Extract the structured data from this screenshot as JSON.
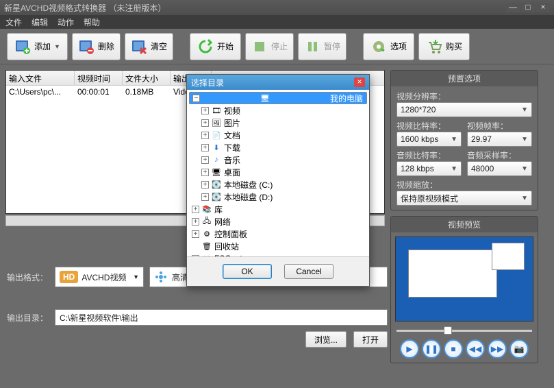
{
  "window": {
    "title": "新星AVCHD视频格式转换器  （未注册版本）"
  },
  "menu": {
    "file": "文件",
    "edit": "编辑",
    "action": "动作",
    "help": "帮助"
  },
  "toolbar": {
    "add": "添加",
    "delete": "删除",
    "clear": "清空",
    "start": "开始",
    "stop": "停止",
    "pause": "暂停",
    "options": "选项",
    "buy": "购买"
  },
  "table": {
    "headers": {
      "file": "输入文件",
      "time": "视频时间",
      "size": "文件大小",
      "format": "输出格式"
    },
    "rows": [
      {
        "file": "C:\\Users\\pc\\...",
        "time": "00:00:01",
        "size": "0.18MB",
        "format": "Vide"
      }
    ]
  },
  "preset": {
    "title": "预置选项",
    "resolution_label": "视频分辨率：",
    "resolution": "1280*720",
    "vbitrate_label": "视频比特率：",
    "vbitrate": "1600 kbps",
    "fps_label": "视频帧率：",
    "fps": "29.97",
    "abitrate_label": "音频比特率：",
    "abitrate": "128 kbps",
    "asample_label": "音频采样率：",
    "asample": "48000",
    "scale_label": "视频缩放：",
    "scale": "保持原视频模式"
  },
  "preview": {
    "title": "视频预览"
  },
  "output": {
    "format_label": "输出格式：",
    "hd": "HD",
    "format_type": "AVCHD视频",
    "format_value": "高清AVI视频格式(*.avi)",
    "dir_label": "输出目录：",
    "dir_value": "C:\\新星视频软件\\输出",
    "browse": "浏览...",
    "open": "打开"
  },
  "dialog": {
    "title": "选择目录",
    "ok": "OK",
    "cancel": "Cancel",
    "tree": {
      "my_computer": "我的电脑",
      "video": "视频",
      "pictures": "图片",
      "documents": "文档",
      "downloads": "下载",
      "music": "音乐",
      "desktop": "桌面",
      "disk_c": "本地磁盘 (C:)",
      "disk_d": "本地磁盘 (D:)",
      "library": "库",
      "network": "网络",
      "control_panel": "控制面板",
      "recycle": "回收站",
      "fscapture": "FSCapture"
    }
  }
}
